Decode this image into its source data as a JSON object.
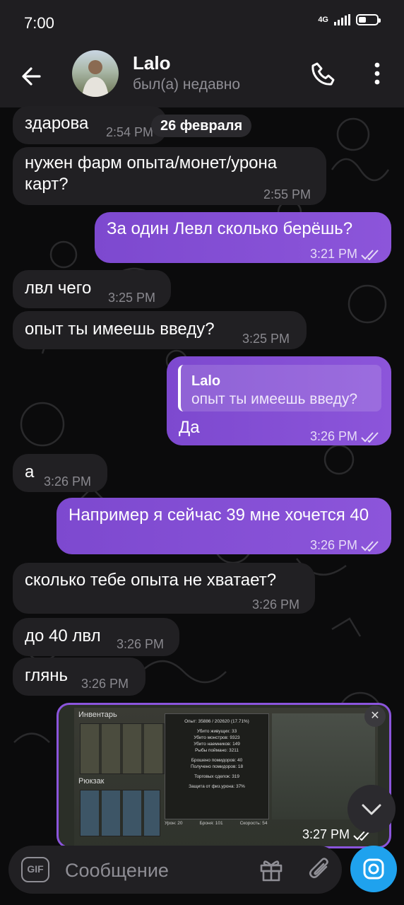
{
  "status_bar": {
    "time": "7:00",
    "network": "4G"
  },
  "header": {
    "name": "Lalo",
    "status": "был(а) недавно"
  },
  "date_chip": "26 февраля",
  "messages": [
    {
      "dir": "in",
      "text": "здарова",
      "time": "2:54 PM"
    },
    {
      "dir": "in",
      "text": "нужен фарм опыта/монет/урона карт?",
      "time": "2:55 PM"
    },
    {
      "dir": "out",
      "text": "За один Левл сколько берёшь?",
      "time": "3:21 PM"
    },
    {
      "dir": "in",
      "text": "лвл чего",
      "time": "3:25 PM"
    },
    {
      "dir": "in",
      "text": "опыт ты имеешь введу?",
      "time": "3:25 PM"
    },
    {
      "dir": "out",
      "text": "Да",
      "time": "3:26 PM",
      "reply_to": {
        "name": "Lalo",
        "text": "опыт ты имеешь введу?"
      }
    },
    {
      "dir": "in",
      "text": "а",
      "time": "3:26 PM"
    },
    {
      "dir": "out",
      "text": "Например я сейчас 39 мне хочется 40",
      "time": "3:26 PM"
    },
    {
      "dir": "in",
      "text": "сколько тебе опыта не хватает?",
      "time": "3:26 PM"
    },
    {
      "dir": "in",
      "text": "до 40 лвл",
      "time": "3:26 PM"
    },
    {
      "dir": "in",
      "text": "глянь",
      "time": "3:26 PM"
    }
  ],
  "media": {
    "time": "3:27 PM",
    "game": {
      "inventory_label": "Инвентарь",
      "backpack_label": "Рюкзак",
      "stats": [
        "Опыт: 35886 / 202620 (17.71%)",
        "Убито живущих: 33",
        "Убито монстров: 9323",
        "Убито наемников: 149",
        "Рыбы поймано: 3211",
        "Брошено помидоров: 40",
        "Получено помидоров: 18",
        "Торговых сделок: 319",
        "Защита от физ.урона: 37%"
      ],
      "bottom": [
        "Урон: 20",
        "Броня: 101",
        "Скорость: 54"
      ]
    }
  },
  "input": {
    "placeholder": "Сообщение",
    "gif_label": "GIF"
  },
  "colors": {
    "outgoing": "#7d49cf",
    "incoming": "#212023",
    "accent": "#1fa2ee"
  }
}
